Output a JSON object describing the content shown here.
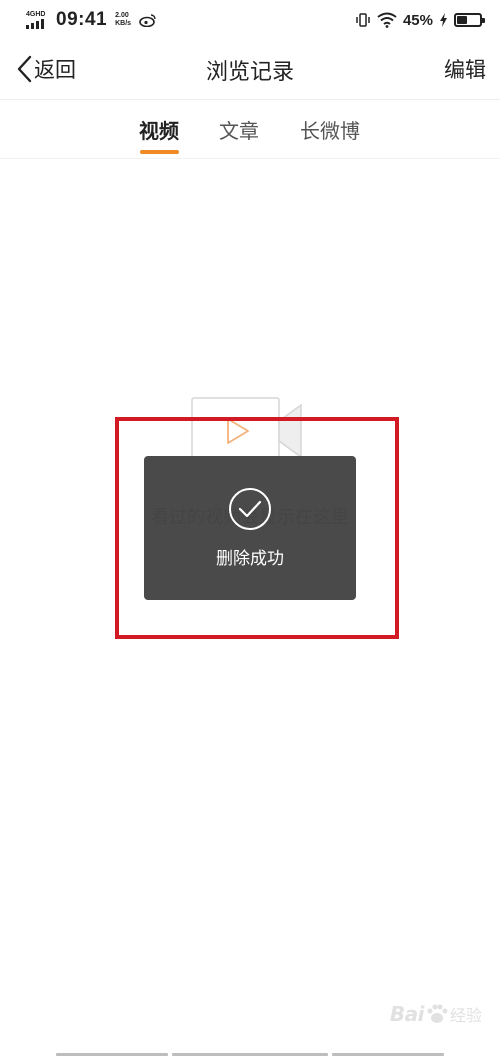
{
  "status_bar": {
    "network": "4GHD",
    "time": "09:41",
    "speed_value": "2.00",
    "speed_unit": "KB/s",
    "battery_percent": "45%",
    "battery_level": 0.45
  },
  "navbar": {
    "back_label": "返回",
    "title": "浏览记录",
    "edit_label": "编辑"
  },
  "tabs": [
    {
      "label": "视频",
      "active": true
    },
    {
      "label": "文章",
      "active": false
    },
    {
      "label": "长微博",
      "active": false
    }
  ],
  "empty_state": {
    "message": "看过的视频会显示在这里"
  },
  "toast": {
    "message": "删除成功"
  },
  "watermark": {
    "brand": "Bai",
    "suffix": "经验"
  },
  "colors": {
    "accent": "#f08a24",
    "highlight": "#d11a24",
    "toast_bg": "#444444"
  }
}
